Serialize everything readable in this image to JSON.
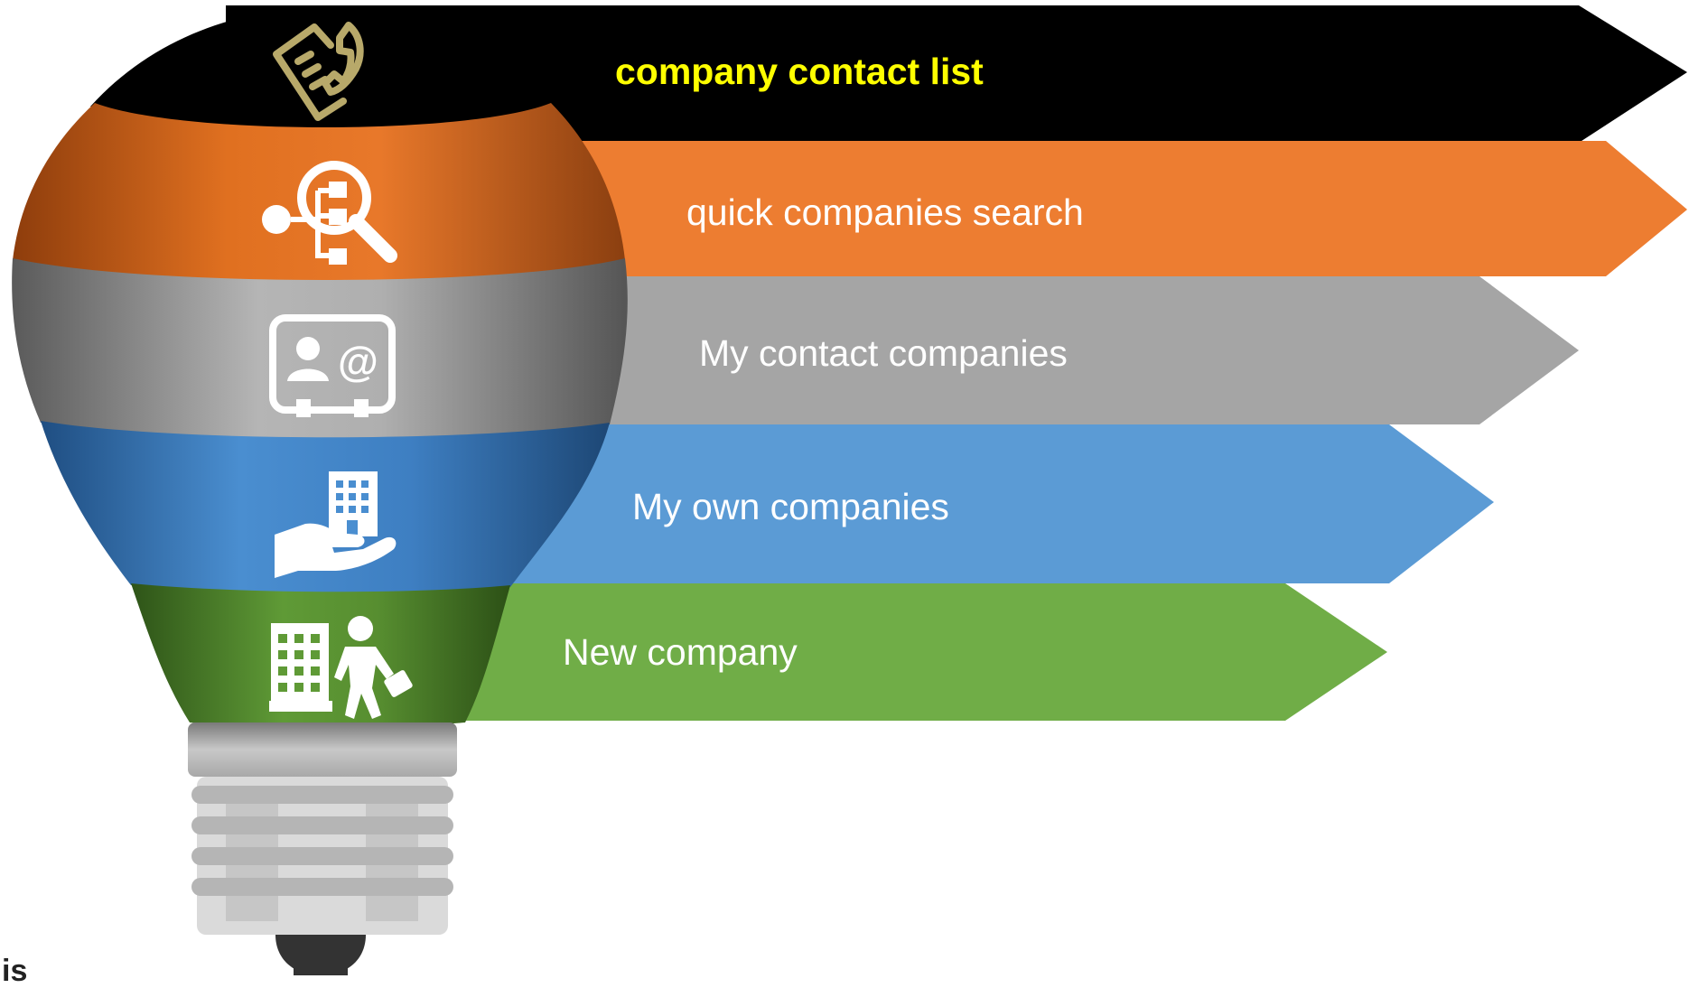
{
  "items": [
    {
      "label": "company contact list",
      "color": "#000000",
      "text_color": "#FFFF00",
      "bold": true,
      "icon": "contact-list-icon"
    },
    {
      "label": "quick companies search",
      "color": "#ED7D31",
      "text_color": "#FFFFFF",
      "bold": false,
      "icon": "org-search-icon"
    },
    {
      "label": "My contact companies",
      "color": "#A5A5A5",
      "text_color": "#FFFFFF",
      "bold": false,
      "icon": "contact-card-icon"
    },
    {
      "label": "My own companies",
      "color": "#5B9BD5",
      "text_color": "#FFFFFF",
      "bold": false,
      "icon": "building-in-hand-icon"
    },
    {
      "label": "New company",
      "color": "#70AD47",
      "text_color": "#FFFFFF",
      "bold": false,
      "icon": "building-businessman-icon"
    }
  ],
  "bulb": {
    "base_color": "#BFBFBF",
    "tip_color": "#333333",
    "icon_color": "#B8A96A"
  },
  "cropped_text": "is"
}
